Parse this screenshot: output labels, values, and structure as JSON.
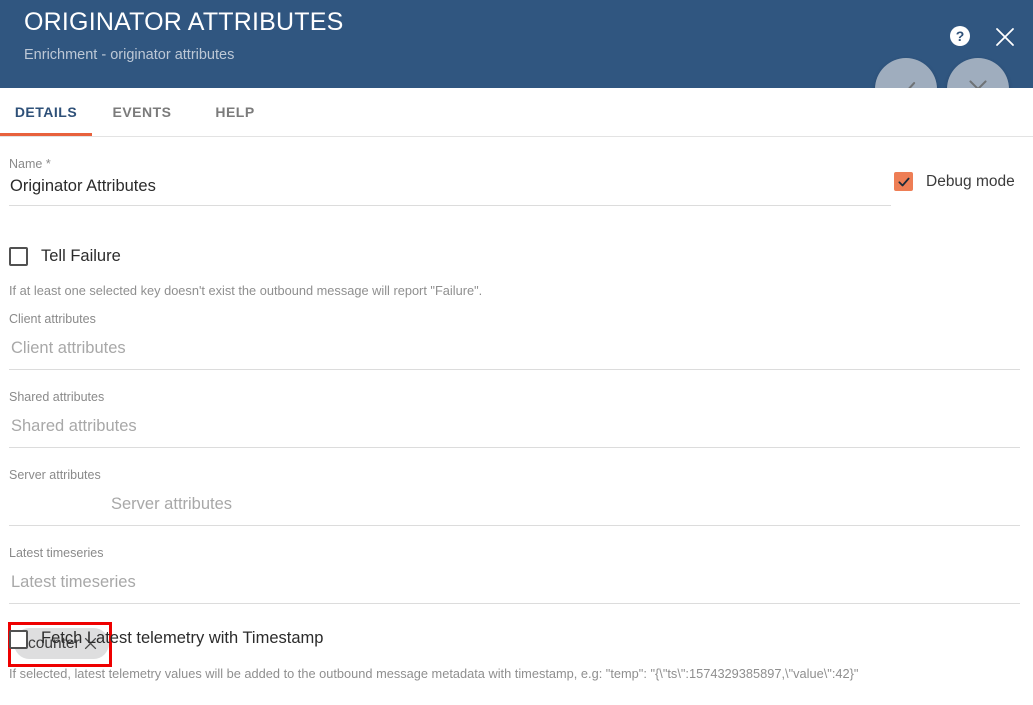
{
  "header": {
    "title": "ORIGINATOR ATTRIBUTES",
    "subtitle": "Enrichment - originator attributes",
    "help_icon": "help-circle-icon",
    "close_icon": "close-icon",
    "background_color": "#305680"
  },
  "actions": {
    "apply_label": "check-icon",
    "cancel_label": "close-icon"
  },
  "tabs": [
    {
      "label": "DETAILS",
      "active": true
    },
    {
      "label": "EVENTS",
      "active": false
    },
    {
      "label": "HELP",
      "active": false
    }
  ],
  "tab_accent_color": "#e8613c",
  "form": {
    "name": {
      "label": "Name *",
      "value": "Originator Attributes",
      "required": true
    },
    "debug_mode": {
      "label": "Debug mode",
      "checked": true,
      "checkbox_color": "#ee7e55"
    },
    "tell_failure": {
      "label": "Tell Failure",
      "checked": false,
      "hint": "If at least one selected key doesn't exist the outbound message will report \"Failure\"."
    },
    "client_attributes": {
      "label": "Client attributes",
      "placeholder": "Client attributes",
      "chips": []
    },
    "shared_attributes": {
      "label": "Shared attributes",
      "placeholder": "Shared attributes",
      "chips": []
    },
    "server_attributes": {
      "label": "Server attributes",
      "placeholder": "Server attributes",
      "chips": [
        {
          "label": "counter",
          "remove_icon": "close-icon"
        }
      ],
      "highlighted": true,
      "highlight_color": "#ee0000"
    },
    "latest_timeseries": {
      "label": "Latest timeseries",
      "placeholder": "Latest timeseries",
      "chips": []
    },
    "fetch_latest_telemetry": {
      "label": "Fetch Latest telemetry with Timestamp",
      "checked": false,
      "hint": "If selected, latest telemetry values will be added to the outbound message metadata with timestamp, e.g: \"temp\": \"{\\\"ts\\\":1574329385897,\\\"value\\\":42}\""
    }
  }
}
